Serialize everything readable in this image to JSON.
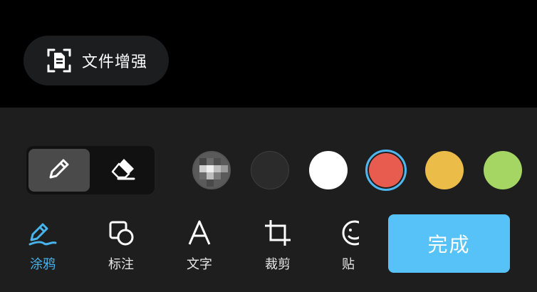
{
  "top": {
    "enhance": {
      "label": "文件增强",
      "icon": "document-scan-icon"
    }
  },
  "toolbar": {
    "tools": [
      {
        "name": "pencil",
        "icon": "pencil-icon",
        "selected": true
      },
      {
        "name": "eraser",
        "icon": "eraser-icon",
        "selected": false
      }
    ],
    "colors": [
      {
        "name": "mosaic",
        "value": "mosaic"
      },
      {
        "name": "dark",
        "value": "#2b2b2b"
      },
      {
        "name": "white",
        "value": "#ffffff"
      },
      {
        "name": "red",
        "value": "#e85c50",
        "selected": true
      },
      {
        "name": "yellow",
        "value": "#ecbc48"
      },
      {
        "name": "green",
        "value": "#a5d562"
      }
    ],
    "selection_ring_color": "#4cb7f0"
  },
  "tabs": [
    {
      "label": "涂鸦",
      "icon": "doodle-pen-icon",
      "active": true
    },
    {
      "label": "标注",
      "icon": "shape-annotation-icon",
      "active": false
    },
    {
      "label": "文字",
      "icon": "text-a-icon",
      "active": false
    },
    {
      "label": "裁剪",
      "icon": "crop-icon",
      "active": false
    },
    {
      "label": "贴",
      "icon": "sticker-smiley-icon",
      "active": false
    }
  ],
  "done": {
    "label": "完成",
    "color": "#56c2f8"
  },
  "accent": "#48b4ee"
}
